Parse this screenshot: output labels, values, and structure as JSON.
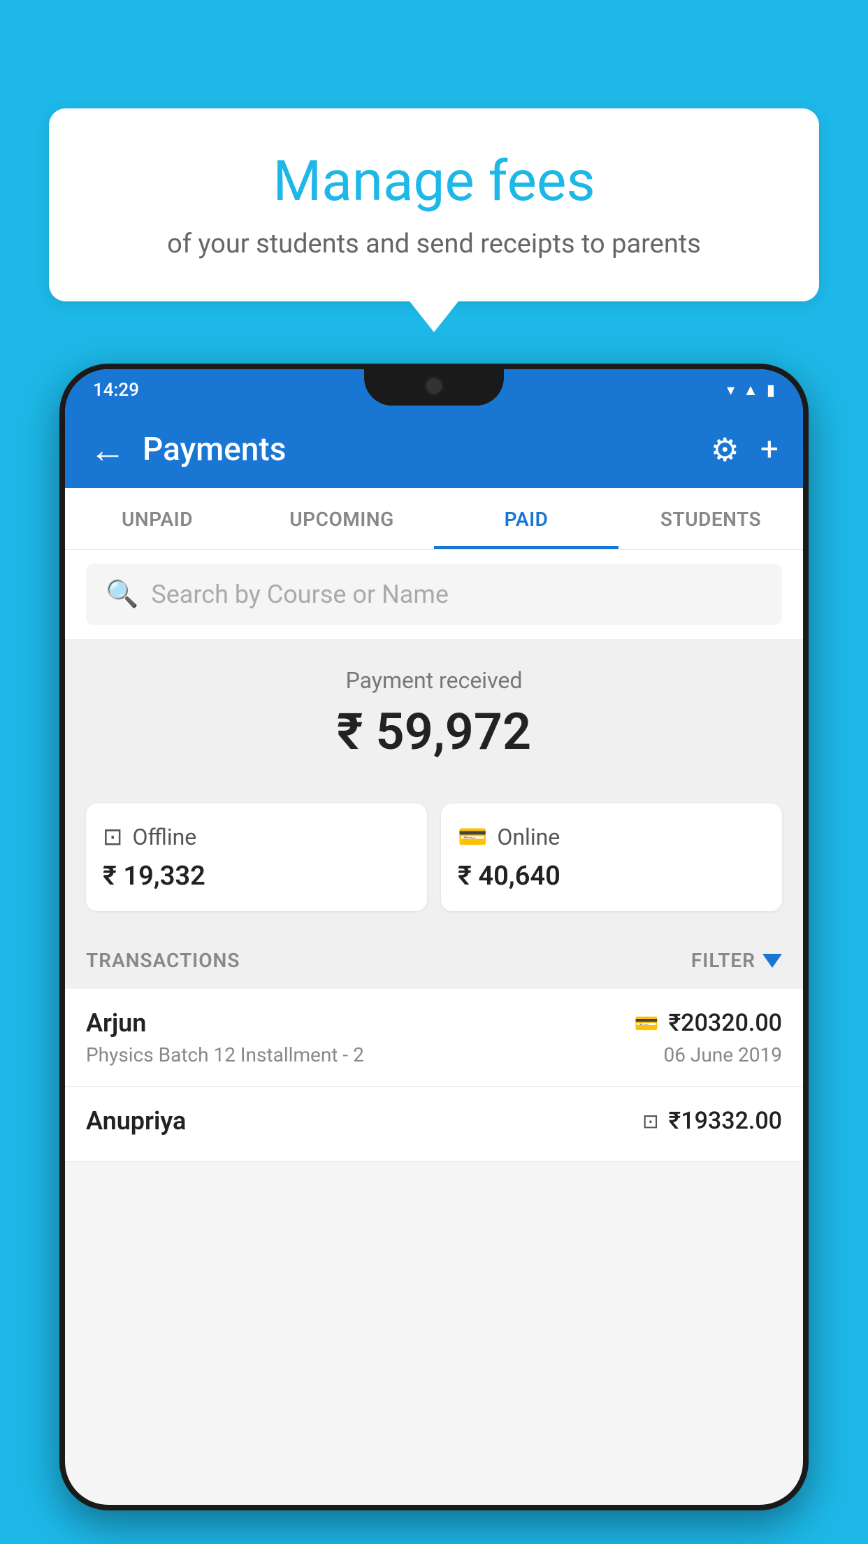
{
  "background_color": "#1db8e8",
  "tooltip": {
    "title": "Manage fees",
    "subtitle": "of your students and send receipts to parents"
  },
  "phone": {
    "status_bar": {
      "time": "14:29",
      "icons": [
        "wifi",
        "signal",
        "battery"
      ]
    },
    "app_bar": {
      "title": "Payments",
      "back_label": "←",
      "settings_icon": "⚙",
      "add_icon": "+"
    },
    "tabs": [
      {
        "label": "UNPAID",
        "active": false
      },
      {
        "label": "UPCOMING",
        "active": false
      },
      {
        "label": "PAID",
        "active": true
      },
      {
        "label": "STUDENTS",
        "active": false
      }
    ],
    "search": {
      "placeholder": "Search by Course or Name"
    },
    "payment_received": {
      "label": "Payment received",
      "amount": "₹ 59,972",
      "offline": {
        "type": "Offline",
        "amount": "₹ 19,332"
      },
      "online": {
        "type": "Online",
        "amount": "₹ 40,640"
      }
    },
    "transactions": {
      "section_label": "TRANSACTIONS",
      "filter_label": "FILTER",
      "items": [
        {
          "name": "Arjun",
          "course": "Physics Batch 12 Installment - 2",
          "amount": "₹20320.00",
          "date": "06 June 2019",
          "type": "online"
        },
        {
          "name": "Anupriya",
          "course": "",
          "amount": "₹19332.00",
          "date": "",
          "type": "offline"
        }
      ]
    }
  }
}
